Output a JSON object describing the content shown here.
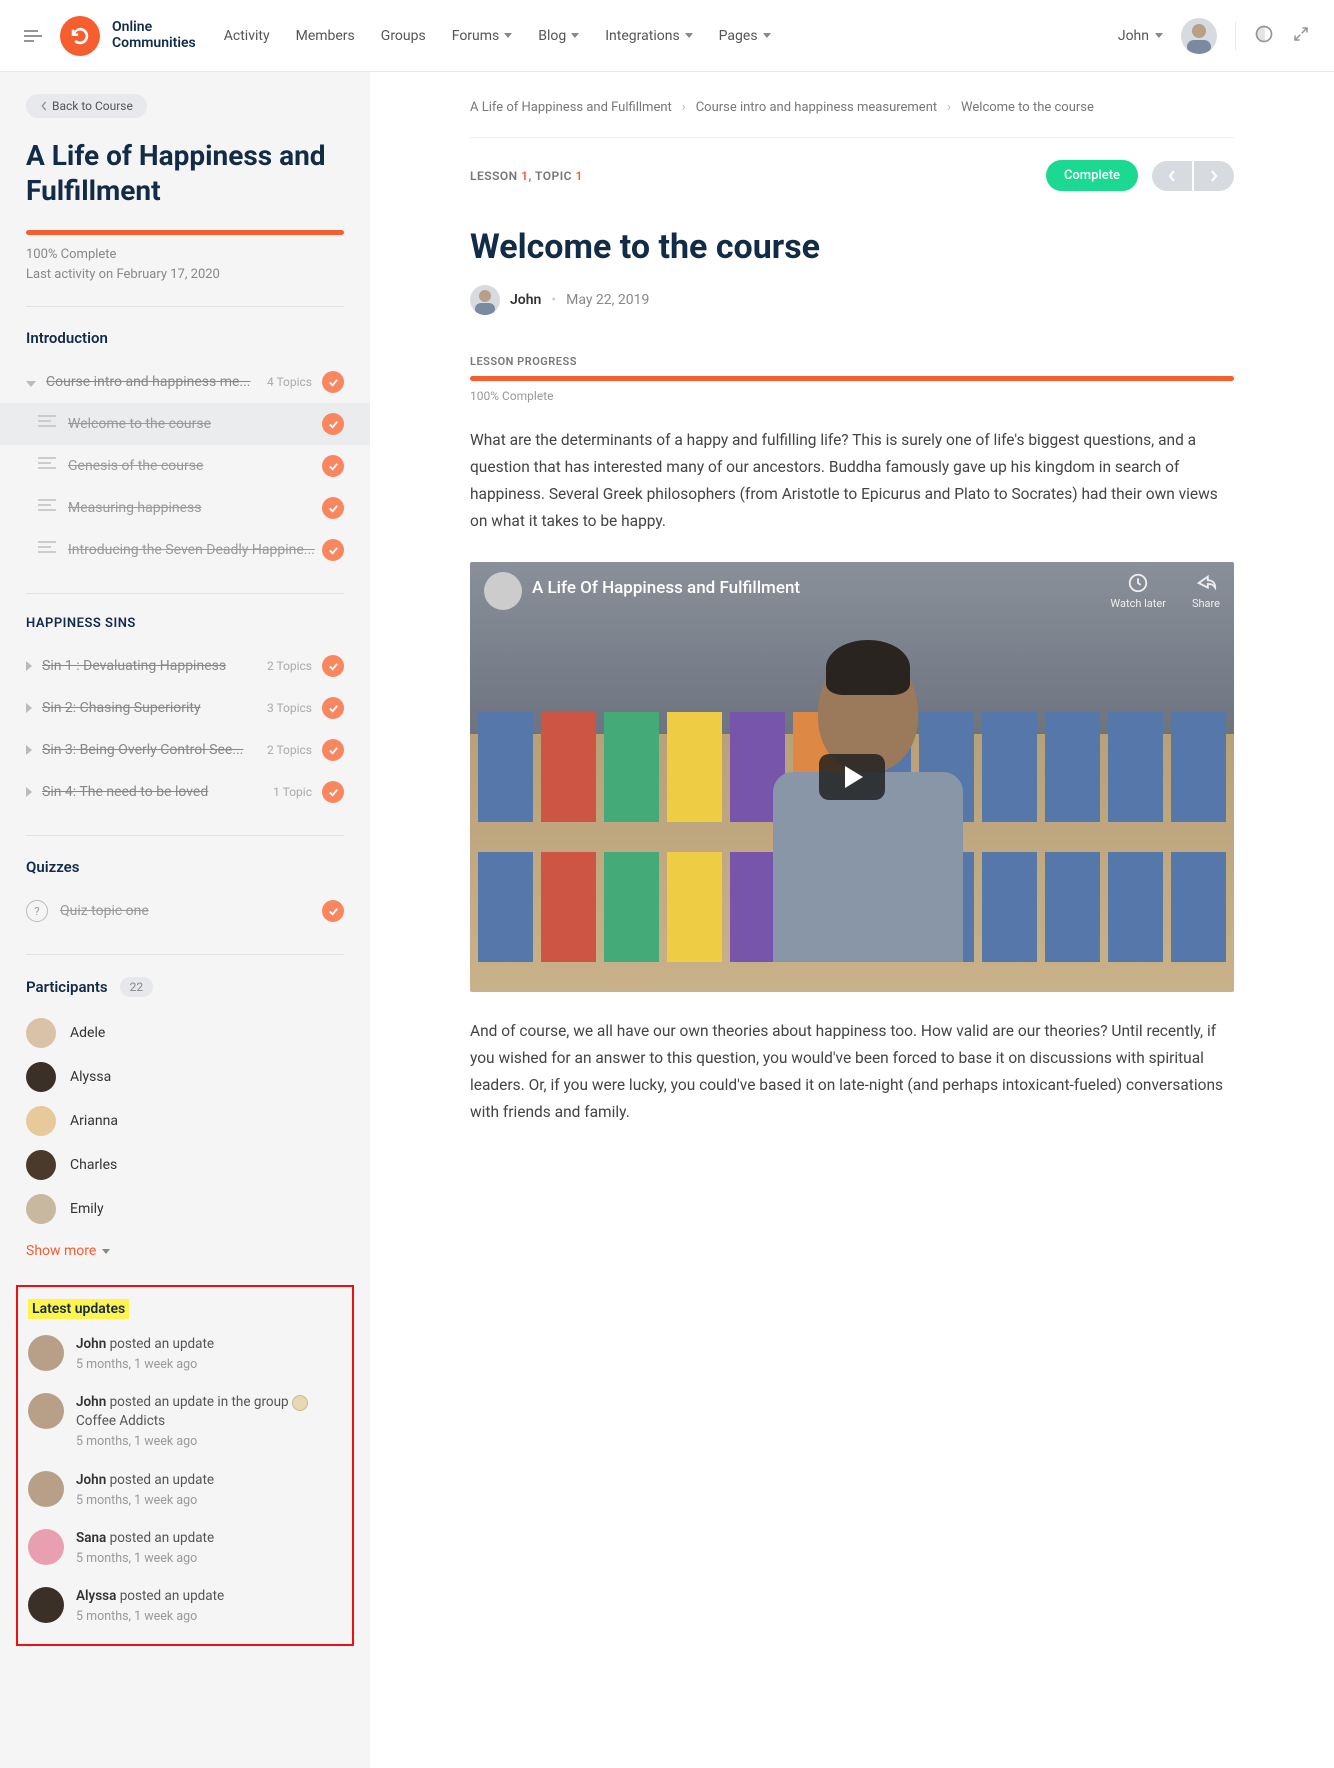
{
  "header": {
    "brand1": "Online",
    "brand2": "Communities",
    "nav": [
      "Activity",
      "Members",
      "Groups",
      "Forums",
      "Blog",
      "Integrations",
      "Pages"
    ],
    "user": "John"
  },
  "sidebar": {
    "back": "Back to Course",
    "title": "A Life of Happiness and Fulfillment",
    "complete": "100% Complete",
    "activity": "Last activity on February 17, 2020",
    "sections": {
      "intro": "Introduction",
      "lesson1": {
        "label": "Course intro and happiness me...",
        "count": "4 Topics"
      },
      "topics": [
        "Welcome to the course",
        "Genesis of the course",
        "Measuring happiness",
        "Introducing the Seven Deadly Happine..."
      ],
      "sins_head": "HAPPINESS SINS",
      "sins": [
        {
          "label": "Sin 1 : Devaluating Happiness",
          "count": "2 Topics"
        },
        {
          "label": "Sin 2: Chasing Superiority",
          "count": "3 Topics"
        },
        {
          "label": "Sin 3: Being Overly Control See...",
          "count": "2 Topics"
        },
        {
          "label": "Sin 4: The need to be loved",
          "count": "1 Topic"
        }
      ],
      "quiz_head": "Quizzes",
      "quiz": "Quiz topic one"
    },
    "participants": {
      "head": "Participants",
      "count": "22",
      "list": [
        "Adele",
        "Alyssa",
        "Arianna",
        "Charles",
        "Emily"
      ],
      "more": "Show more"
    },
    "updates": {
      "head": "Latest updates",
      "items": [
        {
          "name": "John",
          "text": " posted an update",
          "time": "5 months, 1 week ago"
        },
        {
          "name": "John",
          "text": " posted an update in the group ",
          "group": "Coffee Addicts",
          "time": "5 months, 1 week ago"
        },
        {
          "name": "John",
          "text": " posted an update",
          "time": "5 months, 1 week ago"
        },
        {
          "name": "Sana",
          "text": " posted an update",
          "time": "5 months, 1 week ago"
        },
        {
          "name": "Alyssa",
          "text": " posted an update",
          "time": "5 months, 1 week ago"
        }
      ]
    }
  },
  "main": {
    "crumbs": [
      "A Life of Happiness and Fulfillment",
      "Course intro and happiness measurement",
      "Welcome to the course"
    ],
    "lesson_meta": {
      "pre": "LESSON ",
      "l": "1",
      "mid": ", TOPIC ",
      "t": "1"
    },
    "complete": "Complete",
    "title": "Welcome to the course",
    "author": "John",
    "date": "May 22, 2019",
    "lp": "LESSON PROGRESS",
    "lp_txt": "100% Complete",
    "p1": "What are the determinants of a happy and fulfilling life? This is surely one of life's biggest questions, and a question that has interested many of our ancestors. Buddha famously gave up his kingdom in search of happiness. Several Greek philosophers (from Aristotle to Epicurus and Plato to Socrates) had their own views on what it takes to be happy.",
    "video_title": "A Life Of Happiness and Fulfillment",
    "watch_later": "Watch later",
    "share": "Share",
    "p2": "And of course, we all have our own theories about happiness too. How valid are our theories? Until recently, if you wished for an answer to this question, you would've been forced to base it on discussions with spiritual leaders. Or, if you were lucky, you could've based it on late-night (and perhaps intoxicant-fueled) conversations with friends and family."
  }
}
